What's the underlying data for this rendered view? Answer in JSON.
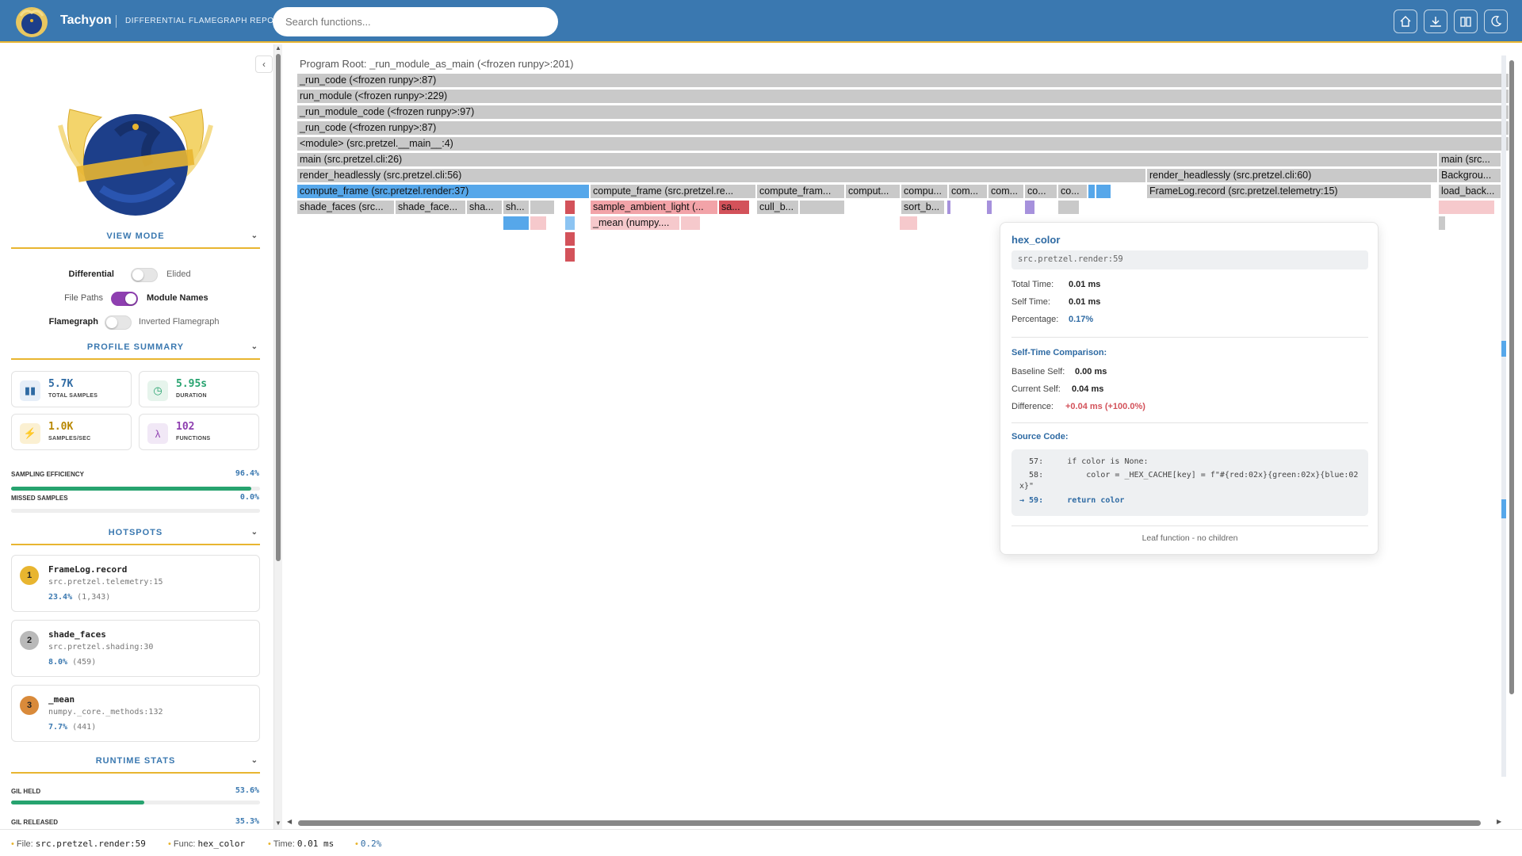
{
  "header": {
    "app_name": "Tachyon",
    "subtitle": "DIFFERENTIAL FLAMEGRAPH REPORT",
    "search_placeholder": "Search functions...",
    "icons": [
      "home-icon",
      "download-icon",
      "book-icon",
      "moon-icon"
    ],
    "accent": "#e8b530",
    "bg": "#3a78b0"
  },
  "sidebar": {
    "view_mode": {
      "title": "VIEW MODE",
      "toggles": [
        {
          "left": "Differential",
          "right": "Elided",
          "state": "off",
          "bold": "left"
        },
        {
          "left": "File Paths",
          "right": "Module Names",
          "state": "on",
          "bold": "right"
        },
        {
          "left": "Flamegraph",
          "right": "Inverted Flamegraph",
          "state": "off",
          "bold": "left"
        }
      ]
    },
    "profile_summary": {
      "title": "PROFILE SUMMARY",
      "cards": [
        {
          "value": "5.7K",
          "label": "TOTAL SAMPLES",
          "icon": "bar-chart-icon",
          "color": "#2e6aa3"
        },
        {
          "value": "5.95s",
          "label": "DURATION",
          "icon": "timer-icon",
          "color": "#27a36f"
        },
        {
          "value": "1.0K",
          "label": "SAMPLES/SEC",
          "icon": "lightning-icon",
          "color": "#c99000"
        },
        {
          "value": "102",
          "label": "FUNCTIONS",
          "icon": "lambda-icon",
          "color": "#8e3fb0"
        }
      ],
      "sampling_efficiency_label": "SAMPLING EFFICIENCY",
      "sampling_efficiency": "96.4%",
      "sampling_efficiency_fraction": 0.964,
      "missed_samples_label": "MISSED SAMPLES",
      "missed_samples": "0.0%",
      "missed_samples_fraction": 0.0
    },
    "hotspots": {
      "title": "HOTSPOTS",
      "items": [
        {
          "rank": "1",
          "name": "FrameLog.record",
          "location": "src.pretzel.telemetry:15",
          "pct": "23.4%",
          "count": "(1,343)",
          "badge": "#e8b530"
        },
        {
          "rank": "2",
          "name": "shade_faces",
          "location": "src.pretzel.shading:30",
          "pct": "8.0%",
          "count": "(459)",
          "badge": "#b9b9b9"
        },
        {
          "rank": "3",
          "name": "_mean",
          "location": "numpy._core._methods:132",
          "pct": "7.7%",
          "count": "(441)",
          "badge": "#d98a3a"
        }
      ]
    },
    "runtime_stats": {
      "title": "RUNTIME STATS",
      "gil_held_label": "GIL HELD",
      "gil_held": "53.6%",
      "gil_held_fraction": 0.536,
      "gil_released_label": "GIL RELEASED",
      "gil_released": "35.3%"
    }
  },
  "flamegraph": {
    "root_label": "Program Root: _run_module_as_main (<frozen runpy>:201)",
    "frames": [
      {
        "text": "_run_code (<frozen runpy>:87)",
        "color": "gray"
      },
      {
        "text": "run_module (<frozen runpy>:229)",
        "color": "gray"
      },
      {
        "text": "_run_module_code (<frozen runpy>:97)",
        "color": "gray"
      },
      {
        "text": "_run_code (<frozen runpy>:87)",
        "color": "gray"
      },
      {
        "text": "<module> (src.pretzel.__main__:4)",
        "color": "gray"
      },
      {
        "text": "main (src.pretzel.cli:26)",
        "color": "gray"
      },
      {
        "text": "main (src...",
        "color": "gray"
      },
      {
        "text": "render_headlessly (src.pretzel.cli:56)",
        "color": "gray"
      },
      {
        "text": "render_headlessly (src.pretzel.cli:60)",
        "color": "gray"
      },
      {
        "text": "Backgrou...",
        "color": "gray"
      },
      {
        "text": "compute_frame (src.pretzel.render:37)",
        "color": "blue"
      },
      {
        "text": "compute_frame (src.pretzel.re...",
        "color": "gray"
      },
      {
        "text": "compute_fram...",
        "color": "gray"
      },
      {
        "text": "comput...",
        "color": "gray"
      },
      {
        "text": "compu...",
        "color": "gray"
      },
      {
        "text": "com...",
        "color": "gray"
      },
      {
        "text": "com...",
        "color": "gray"
      },
      {
        "text": "co...",
        "color": "gray"
      },
      {
        "text": "co...",
        "color": "gray"
      },
      {
        "text": "FrameLog.record (src.pretzel.telemetry:15)",
        "color": "gray"
      },
      {
        "text": "load_back...",
        "color": "gray"
      },
      {
        "text": "shade_faces (src...",
        "color": "gray"
      },
      {
        "text": "shade_face...",
        "color": "gray"
      },
      {
        "text": "sha...",
        "color": "gray"
      },
      {
        "text": "sh...",
        "color": "gray"
      },
      {
        "text": "sample_ambient_light (...",
        "color": "pink"
      },
      {
        "text": "sa...",
        "color": "red"
      },
      {
        "text": "cull_b...",
        "color": "gray"
      },
      {
        "text": "sort_b...",
        "color": "gray"
      },
      {
        "text": "_mean (numpy....",
        "color": "lpink"
      }
    ]
  },
  "tooltip": {
    "title": "hex_color",
    "location": "src.pretzel.render:59",
    "total_time_label": "Total Time:",
    "total_time": "0.01 ms",
    "self_time_label": "Self Time:",
    "self_time": "0.01 ms",
    "percentage_label": "Percentage:",
    "percentage": "0.17%",
    "comparison_title": "Self-Time Comparison:",
    "baseline_label": "Baseline Self:",
    "baseline": "0.00 ms",
    "current_label": "Current Self:",
    "current": "0.04 ms",
    "difference_label": "Difference:",
    "difference": "+0.04 ms (+100.0%)",
    "source_title": "Source Code:",
    "code": [
      "  57:     if color is None:",
      "  58:         color = _HEX_CACHE[key] = f\"#{red:02x}{green:02x}{blue:02",
      "x}\"",
      "→ 59:     return color"
    ],
    "footer": "Leaf function - no children"
  },
  "statusbar": {
    "file_label": "File:",
    "file": "src.pretzel.render:59",
    "func_label": "Func:",
    "func": "hex_color",
    "time_label": "Time:",
    "time": "0.01 ms",
    "pct": "0.2%"
  }
}
